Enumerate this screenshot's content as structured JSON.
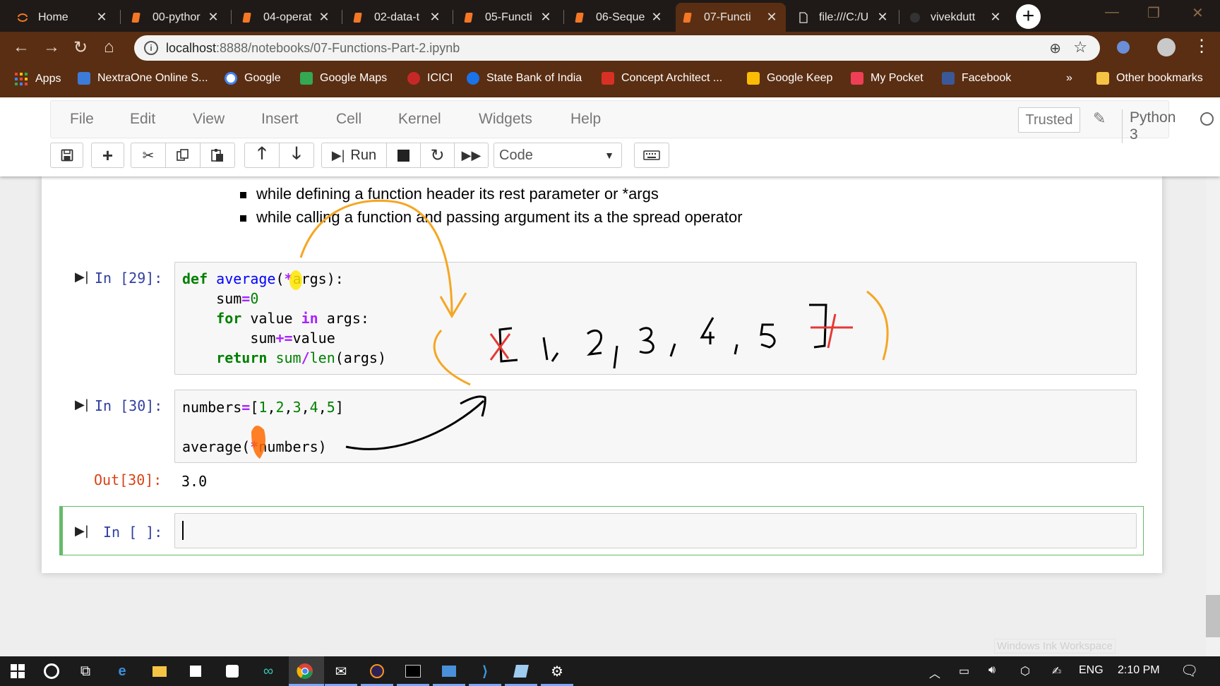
{
  "tabs": [
    {
      "label": "Home",
      "icon": "jupyter-icon",
      "active": false
    },
    {
      "label": "00-pythor",
      "icon": "notebook-icon",
      "active": false
    },
    {
      "label": "04-operat",
      "icon": "notebook-icon",
      "active": false
    },
    {
      "label": "02-data-t",
      "icon": "notebook-icon",
      "active": false
    },
    {
      "label": "05-Functi",
      "icon": "notebook-icon",
      "active": false
    },
    {
      "label": "06-Seque",
      "icon": "notebook-icon",
      "active": false
    },
    {
      "label": "07-Functi",
      "icon": "notebook-icon",
      "active": true
    },
    {
      "label": "file:///C:/U",
      "icon": "file-icon",
      "active": false
    },
    {
      "label": "vivekdutt",
      "icon": "github-icon",
      "active": false
    }
  ],
  "address": {
    "host": "localhost",
    "rest": ":8888/notebooks/07-Functions-Part-2.ipynb"
  },
  "bookmarks": {
    "apps": "Apps",
    "items": [
      "NextraOne Online S...",
      "Google",
      "Google Maps",
      "ICICI",
      "State Bank of India",
      "Concept Architect ...",
      "Google Keep",
      "My Pocket",
      "Facebook"
    ],
    "more": "»",
    "other": "Other bookmarks"
  },
  "jupyter": {
    "menu": [
      "File",
      "Edit",
      "View",
      "Insert",
      "Cell",
      "Kernel",
      "Widgets",
      "Help"
    ],
    "trusted": "Trusted",
    "kernel": "Python 3",
    "run_label": "Run",
    "cell_type": "Code"
  },
  "notebook": {
    "bullets": [
      "while defining a function header its rest parameter or *args",
      "while calling a function and passing argument its a the spread operator"
    ],
    "cell29": {
      "prompt": "In [29]:",
      "lines": [
        "def average(*args):",
        "    sum=0",
        "    for value in args:",
        "        sum+=value",
        "    return sum/len(args)"
      ]
    },
    "cell30": {
      "prompt": "In [30]:",
      "lines": [
        "numbers=[1,2,3,4,5]",
        "",
        "average(*numbers)"
      ],
      "out_prompt": "Out[30]:",
      "output": "3.0"
    },
    "empty_cell": {
      "prompt": "In [ ]:"
    }
  },
  "ink_watermark": "Windows Ink Workspace",
  "taskbar": {
    "lang": "ENG",
    "time": "2:10 PM"
  },
  "colors": {
    "chrome_frame": "#5a2e12",
    "ink_orange": "#f5a623",
    "ink_red": "#e53935",
    "jupyter_prompt": "#303f9f",
    "out_prompt": "#d84315"
  }
}
